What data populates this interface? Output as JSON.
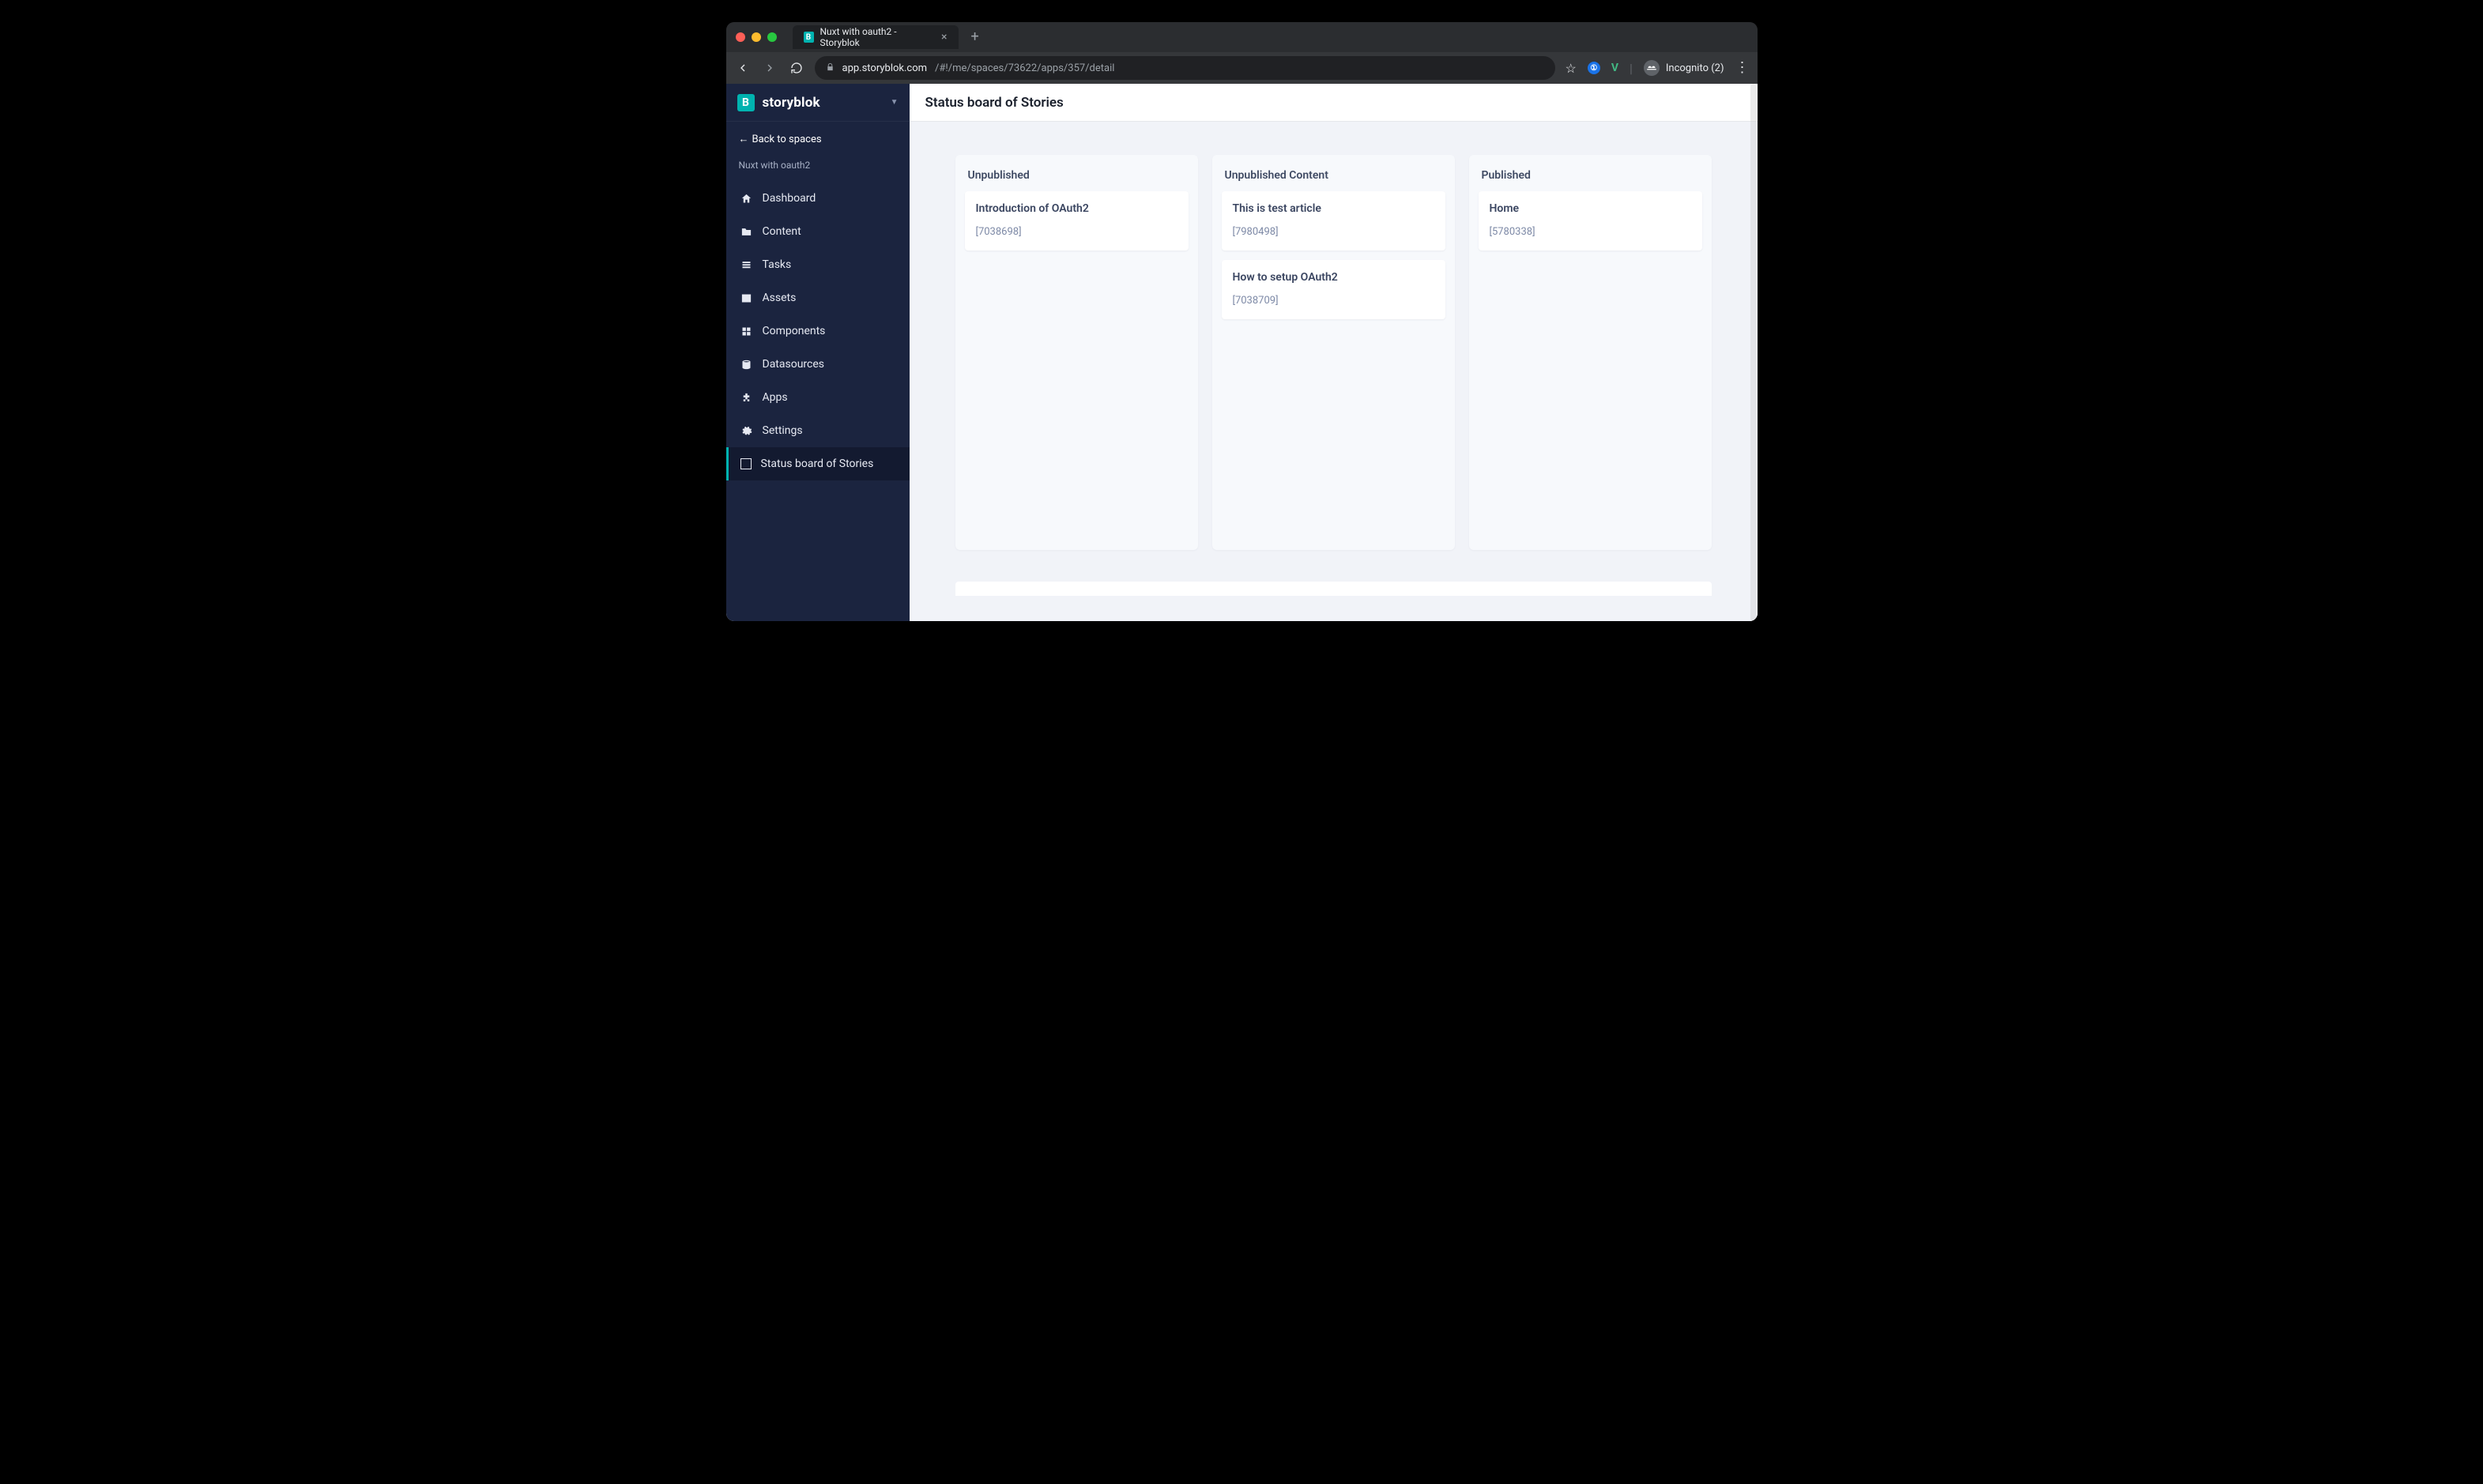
{
  "browser": {
    "tab_title": "Nuxt with oauth2 - Storyblok",
    "url_host": "app.storyblok.com",
    "url_path": "/#!/me/spaces/73622/apps/357/detail",
    "incognito_label": "Incognito (2)"
  },
  "sidebar": {
    "brand": "storyblok",
    "back_label": "Back to spaces",
    "space_name": "Nuxt with oauth2",
    "items": [
      {
        "label": "Dashboard",
        "icon": "home"
      },
      {
        "label": "Content",
        "icon": "folder"
      },
      {
        "label": "Tasks",
        "icon": "list"
      },
      {
        "label": "Assets",
        "icon": "image"
      },
      {
        "label": "Components",
        "icon": "blocks"
      },
      {
        "label": "Datasources",
        "icon": "database"
      },
      {
        "label": "Apps",
        "icon": "puzzle"
      },
      {
        "label": "Settings",
        "icon": "gear"
      },
      {
        "label": "Status board of Stories",
        "icon": "box",
        "active": true
      }
    ]
  },
  "page": {
    "title": "Status board of Stories",
    "columns": [
      {
        "title": "Unpublished",
        "cards": [
          {
            "title": "Introduction of OAuth2",
            "id": "[7038698]"
          }
        ]
      },
      {
        "title": "Unpublished Content",
        "cards": [
          {
            "title": "This is test article",
            "id": "[7980498]"
          },
          {
            "title": "How to setup OAuth2",
            "id": "[7038709]"
          }
        ]
      },
      {
        "title": "Published",
        "cards": [
          {
            "title": "Home",
            "id": "[5780338]"
          }
        ]
      }
    ]
  }
}
